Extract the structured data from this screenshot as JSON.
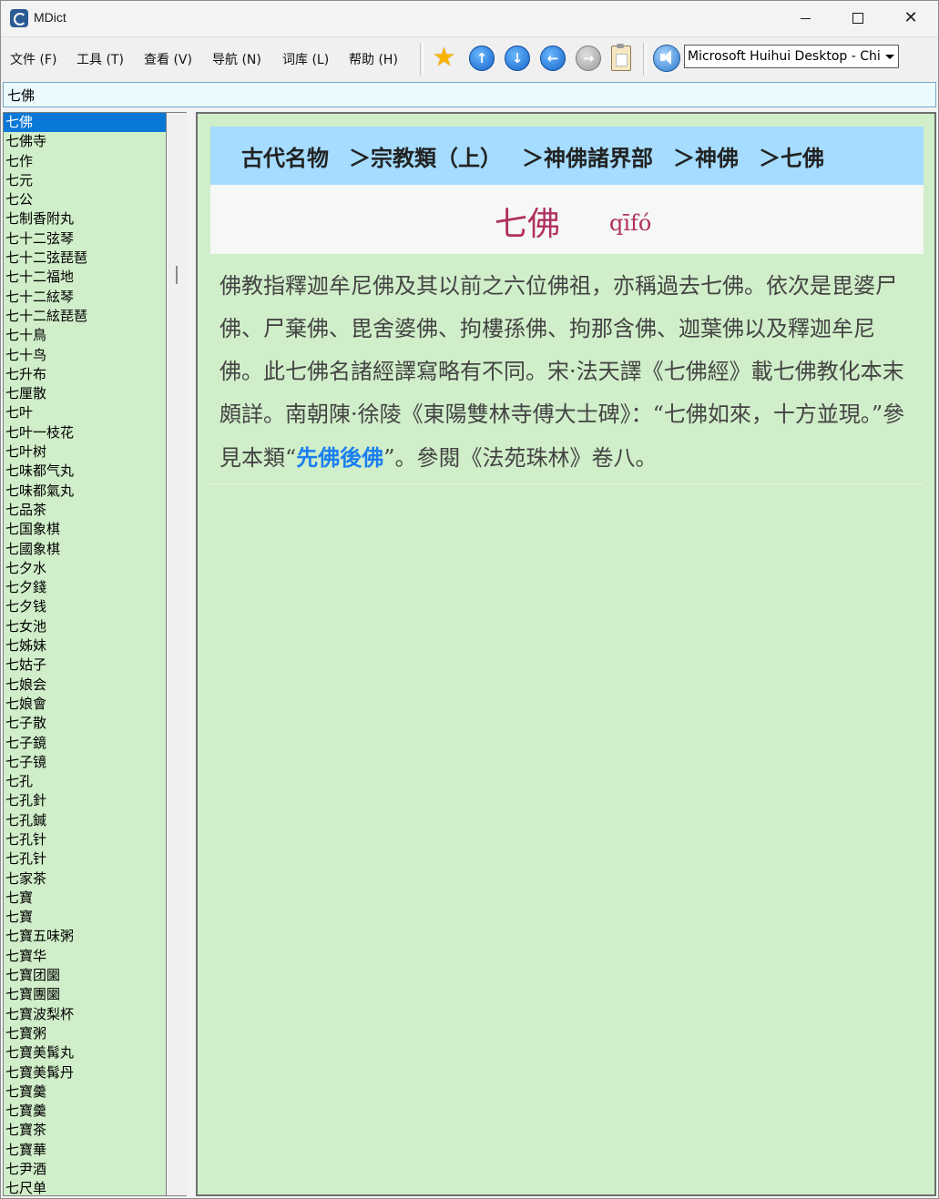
{
  "window": {
    "title": "MDict"
  },
  "menu": {
    "file": "文件 (F)",
    "tools": "工具 (T)",
    "view": "查看 (V)",
    "navigate": "导航 (N)",
    "library": "词库 (L)",
    "help": "帮助 (H)"
  },
  "toolbar": {
    "icons": [
      "star-icon",
      "arrow-up-icon",
      "arrow-down-icon",
      "arrow-left-icon",
      "arrow-right-icon",
      "clipboard-icon",
      "speaker-icon"
    ],
    "dictionary_selected": "Microsoft Huihui Desktop - Chinese"
  },
  "search": {
    "value": "七佛"
  },
  "word_list": [
    "七佛",
    "七佛寺",
    "七作",
    "七元",
    "七公",
    "七制香附丸",
    "七十二弦琴",
    "七十二弦琵琶",
    "七十二福地",
    "七十二絃琴",
    "七十二絃琵琶",
    "七十鳥",
    "七十鸟",
    "七升布",
    "七厘散",
    "七叶",
    "七叶一枝花",
    "七叶树",
    "七味都气丸",
    "七味都氣丸",
    "七品茶",
    "七国象棋",
    "七國象棋",
    "七夕水",
    "七夕錢",
    "七夕钱",
    "七女池",
    "七姊妹",
    "七姑子",
    "七娘会",
    "七娘會",
    "七子散",
    "七子鏡",
    "七子镜",
    "七孔",
    "七孔針",
    "七孔鍼",
    "七孔针",
    "七孔针",
    "七家茶",
    "七寶",
    "七寶",
    "七寶五味粥",
    "七寶华",
    "七寶团圞",
    "七寶團圞",
    "七寶波梨杯",
    "七寶粥",
    "七寶美髯丸",
    "七寶美髯丹",
    "七寶羹",
    "七寶羹",
    "七寶茶",
    "七寶華",
    "七尹酒",
    "七尺单"
  ],
  "selected_index": 0,
  "entry": {
    "breadcrumb": [
      "古代名物",
      "＞宗教類（上）",
      "＞神佛諸界部",
      "＞神佛",
      "＞七佛"
    ],
    "headword": "七佛",
    "pinyin": "qīfó",
    "definition_before": "佛教指釋迦牟尼佛及其以前之六位佛祖，亦稱過去七佛。依次是毘婆尸佛、尸棄佛、毘舍婆佛、拘樓孫佛、拘那含佛、迦葉佛以及釋迦牟尼佛。此七佛名諸經譯寫略有不同。宋·法天譯《七佛經》載七佛教化本末頗詳。南朝陳·徐陵《東陽雙林寺傅大士碑》：“七佛如來，十方並現。”參見本類“",
    "definition_link": "先佛後佛",
    "definition_after": "”。參閱《法苑珠林》卷八。"
  },
  "colors": {
    "list_background": "#d0eec9",
    "content_background": "#d0eec9",
    "breadcrumb_background": "#a5dcff",
    "headword_color": "#b03060",
    "link_color": "#1a7ff0",
    "selection": "#0a78d7"
  }
}
